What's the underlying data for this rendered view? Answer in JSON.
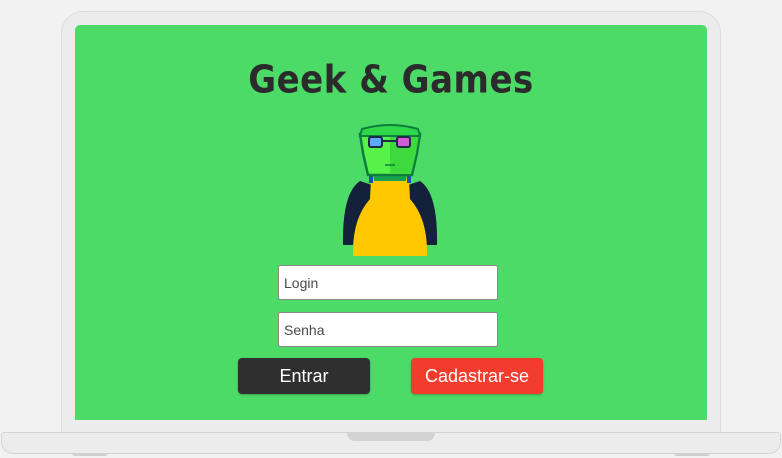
{
  "app": {
    "title": "Geek & Games"
  },
  "form": {
    "login_placeholder": "Login",
    "senha_placeholder": "Senha",
    "login_value": "",
    "senha_value": ""
  },
  "buttons": {
    "entrar_label": "Entrar",
    "cadastrar_label": "Cadastrar-se"
  },
  "icons": {
    "mascot": "geek-mascot-icon"
  },
  "colors": {
    "screen_background": "#4cdb67",
    "title_text": "#2b2b2b",
    "entrar_button": "#2f2f2f",
    "cadastrar_button": "#f23c2e",
    "laptop_frame": "#ececec"
  }
}
